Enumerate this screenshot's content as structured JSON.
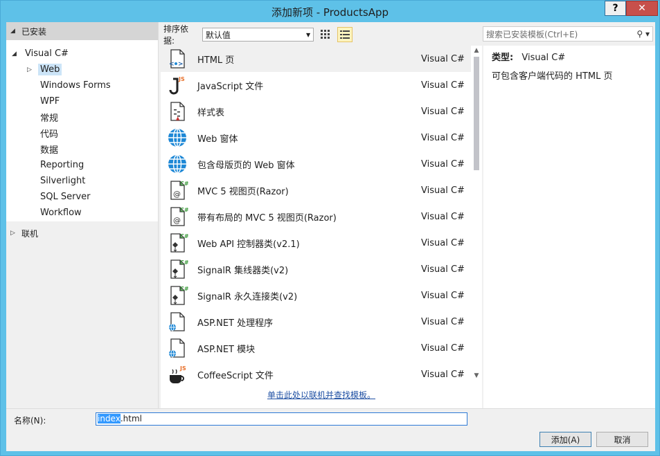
{
  "window": {
    "title": "添加新项 - ProductsApp",
    "help_label": "?",
    "close_label": "✕"
  },
  "left": {
    "installed_label": "已安装",
    "tree": {
      "root_label": "Visual C#",
      "children": [
        "Web",
        "Windows Forms",
        "WPF",
        "常规",
        "代码",
        "数据",
        "Reporting",
        "Silverlight",
        "SQL Server",
        "Workflow"
      ],
      "selected": "Web"
    },
    "online_label": "联机"
  },
  "toolbar": {
    "sort_label": "排序依据:",
    "sort_value": "默认值"
  },
  "search": {
    "placeholder": "搜索已安装模板(Ctrl+E)"
  },
  "templates": [
    {
      "name": "HTML 页",
      "lang": "Visual C#",
      "icon": "html-page-icon"
    },
    {
      "name": "JavaScript 文件",
      "lang": "Visual C#",
      "icon": "javascript-file-icon"
    },
    {
      "name": "样式表",
      "lang": "Visual C#",
      "icon": "stylesheet-icon"
    },
    {
      "name": "Web 窗体",
      "lang": "Visual C#",
      "icon": "globe-icon"
    },
    {
      "name": "包含母版页的 Web 窗体",
      "lang": "Visual C#",
      "icon": "globe-icon"
    },
    {
      "name": "MVC 5 视图页(Razor)",
      "lang": "Visual C#",
      "icon": "razor-view-icon"
    },
    {
      "name": "带有布局的 MVC 5 视图页(Razor)",
      "lang": "Visual C#",
      "icon": "razor-view-icon"
    },
    {
      "name": "Web API 控制器类(v2.1)",
      "lang": "Visual C#",
      "icon": "class-icon"
    },
    {
      "name": "SignalR 集线器类(v2)",
      "lang": "Visual C#",
      "icon": "class-icon"
    },
    {
      "name": "SignalR 永久连接类(v2)",
      "lang": "Visual C#",
      "icon": "class-icon"
    },
    {
      "name": "ASP.NET 处理程序",
      "lang": "Visual C#",
      "icon": "aspnet-file-icon"
    },
    {
      "name": "ASP.NET 模块",
      "lang": "Visual C#",
      "icon": "aspnet-file-icon"
    },
    {
      "name": "CoffeeScript 文件",
      "lang": "Visual C#",
      "icon": "coffee-icon"
    }
  ],
  "online_link": "单击此处以联机并查找模板。",
  "detail": {
    "type_label": "类型:",
    "type_value": "Visual C#",
    "description": "可包含客户端代码的 HTML 页"
  },
  "bottom": {
    "name_label": "名称(N):",
    "name_value_selected": "index",
    "name_value_rest": ".html",
    "add_label": "添加(A)",
    "cancel_label": "取消"
  },
  "colors": {
    "title_bg": "#5ec1e8",
    "close_bg": "#c7504b",
    "link": "#1e4fa3",
    "selection": "#3399ff"
  }
}
